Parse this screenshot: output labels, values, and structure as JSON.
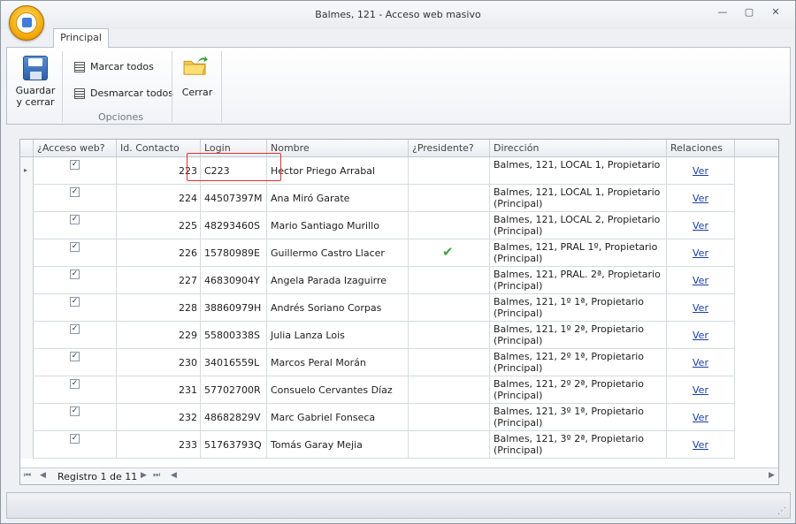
{
  "window": {
    "title": "Balmes, 121 - Acceso web masivo",
    "min": "—",
    "max": "▢",
    "close": "✕"
  },
  "ribbon": {
    "tab": "Principal",
    "save": "Guardar y cerrar",
    "select_all": "Marcar todos",
    "deselect_all": "Desmarcar todos",
    "group": "Opciones",
    "close": "Cerrar"
  },
  "grid": {
    "headers": [
      "¿Acceso web?",
      "Id. Contacto",
      "Login",
      "Nombre",
      "¿Presidente?",
      "Dirección",
      "Relaciones"
    ],
    "rows": [
      {
        "acceso": true,
        "id": "223",
        "login": "C223",
        "nombre": "Hector Priego Arrabal",
        "presidente": false,
        "dir1": "Balmes, 121, LOCAL 1, Propietario",
        "dir2": "",
        "rel": "Ver"
      },
      {
        "acceso": true,
        "id": "224",
        "login": "44507397M",
        "nombre": "Ana Miró Garate",
        "presidente": false,
        "dir1": "Balmes, 121, LOCAL 1, Propietario",
        "dir2": "(Principal)",
        "rel": "Ver"
      },
      {
        "acceso": true,
        "id": "225",
        "login": "48293460S",
        "nombre": "Mario Santiago Murillo",
        "presidente": false,
        "dir1": "Balmes, 121, LOCAL 2, Propietario",
        "dir2": "(Principal)",
        "rel": "Ver"
      },
      {
        "acceso": true,
        "id": "226",
        "login": "15780989E",
        "nombre": "Guillermo Castro Llacer",
        "presidente": true,
        "dir1": "Balmes, 121, PRAL 1º, Propietario",
        "dir2": "(Principal)",
        "rel": "Ver"
      },
      {
        "acceso": true,
        "id": "227",
        "login": "46830904Y",
        "nombre": "Angela Parada Izaguirre",
        "presidente": false,
        "dir1": "Balmes, 121, PRAL. 2ª, Propietario",
        "dir2": "(Principal)",
        "rel": "Ver"
      },
      {
        "acceso": true,
        "id": "228",
        "login": "38860979H",
        "nombre": "Andrés Soriano Corpas",
        "presidente": false,
        "dir1": "Balmes, 121, 1º 1ª, Propietario",
        "dir2": "(Principal)",
        "rel": "Ver"
      },
      {
        "acceso": true,
        "id": "229",
        "login": "55800338S",
        "nombre": "Julia Lanza Lois",
        "presidente": false,
        "dir1": "Balmes, 121, 1º 2ª, Propietario",
        "dir2": "(Principal)",
        "rel": "Ver"
      },
      {
        "acceso": true,
        "id": "230",
        "login": "34016559L",
        "nombre": "Marcos Peral Morán",
        "presidente": false,
        "dir1": "Balmes, 121, 2º 1ª, Propietario",
        "dir2": "(Principal)",
        "rel": "Ver"
      },
      {
        "acceso": true,
        "id": "231",
        "login": "57702700R",
        "nombre": "Consuelo Cervantes Díaz",
        "presidente": false,
        "dir1": "Balmes, 121, 2º 2ª, Propietario",
        "dir2": "(Principal)",
        "rel": "Ver"
      },
      {
        "acceso": true,
        "id": "232",
        "login": "48682829V",
        "nombre": "Marc Gabriel Fonseca",
        "presidente": false,
        "dir1": "Balmes, 121, 3º 1ª, Propietario",
        "dir2": "(Principal)",
        "rel": "Ver"
      },
      {
        "acceso": true,
        "id": "233",
        "login": "51763793Q",
        "nombre": "Tomás Garay Mejia",
        "presidente": false,
        "dir1": "Balmes, 121, 3º 2ª, Propietario",
        "dir2": "(Principal)",
        "rel": "Ver"
      }
    ],
    "footer": {
      "record": "Registro 1 de 11"
    }
  },
  "icons": {
    "check": "✓",
    "presidente": "✔"
  }
}
